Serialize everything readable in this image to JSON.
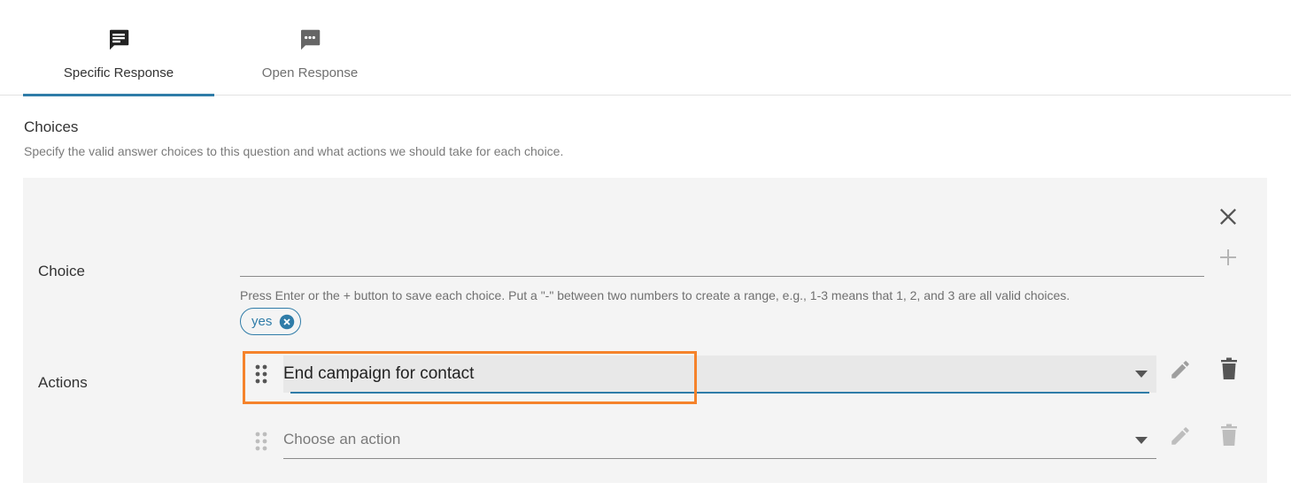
{
  "tabs": [
    {
      "label": "Specific Response",
      "icon": "message-lines-icon",
      "active": true
    },
    {
      "label": "Open Response",
      "icon": "message-dots-icon",
      "active": false
    }
  ],
  "section": {
    "title": "Choices",
    "description": "Specify the valid answer choices to this question and what actions we should take for each choice."
  },
  "choice": {
    "label": "Choice",
    "input_value": "",
    "hint": "Press Enter or the + button to save each choice. Put a \"-\" between two numbers to create a range, e.g., 1-3 means that 1, 2, and 3 are all valid choices.",
    "chips": [
      "yes"
    ]
  },
  "actions": {
    "label": "Actions",
    "rows": [
      {
        "value": "End campaign for contact",
        "placeholder": "Choose an action"
      },
      {
        "value": "",
        "placeholder": "Choose an action"
      }
    ]
  },
  "colors": {
    "accent": "#2f7ca8",
    "highlight": "#f5832b",
    "panel": "#f4f4f4"
  }
}
